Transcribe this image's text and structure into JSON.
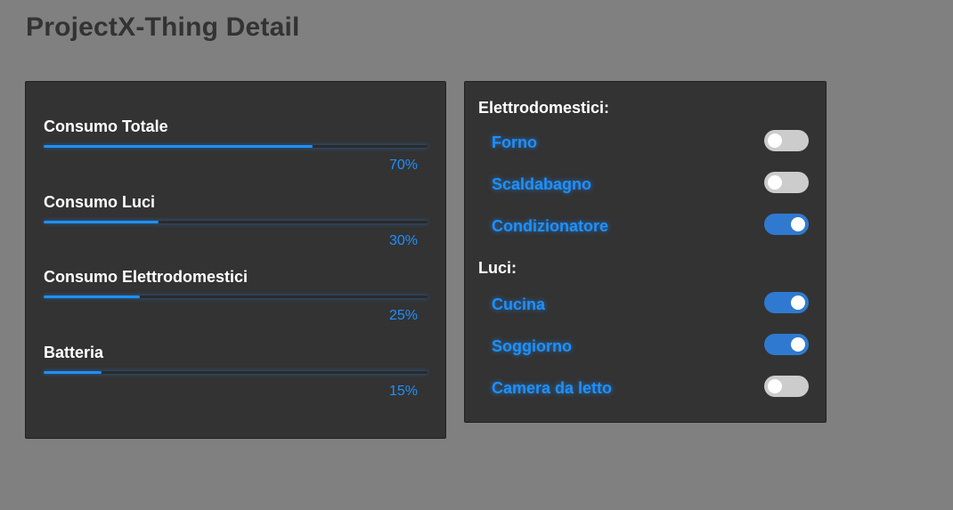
{
  "page": {
    "title": "ProjectX-Thing Detail"
  },
  "colors": {
    "background": "#808080",
    "panel": "#333333",
    "accent": "#1e90ff",
    "toggle_on": "#2f7ad0",
    "toggle_off": "#cccccc"
  },
  "consumption": {
    "meters": [
      {
        "label": "Consumo Totale",
        "value_text": "70%",
        "value": 70
      },
      {
        "label": "Consumo Luci",
        "value_text": "30%",
        "value": 30
      },
      {
        "label": "Consumo Elettrodomestici",
        "value_text": "25%",
        "value": 25
      },
      {
        "label": "Batteria",
        "value_text": "15%",
        "value": 15
      }
    ]
  },
  "devices": {
    "appliances": {
      "heading": "Elettrodomestici:",
      "items": [
        {
          "label": "Forno",
          "on": false
        },
        {
          "label": "Scaldabagno",
          "on": false
        },
        {
          "label": "Condizionatore",
          "on": true
        }
      ]
    },
    "lights": {
      "heading": "Luci:",
      "items": [
        {
          "label": "Cucina",
          "on": true
        },
        {
          "label": "Soggiorno",
          "on": true
        },
        {
          "label": "Camera da letto",
          "on": false
        }
      ]
    }
  }
}
